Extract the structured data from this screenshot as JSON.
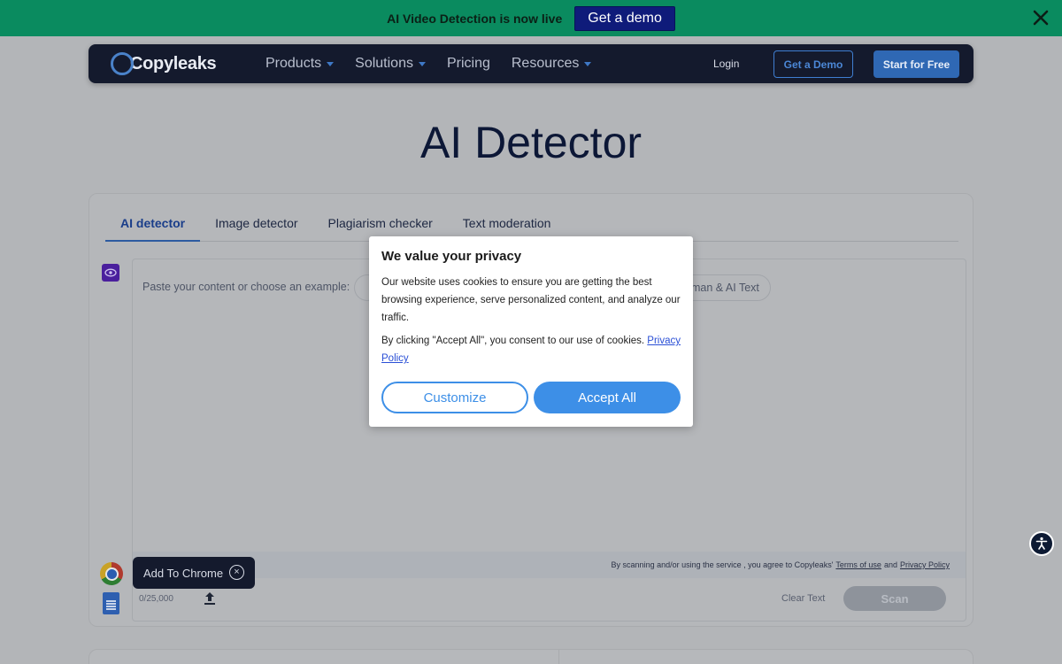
{
  "promo": {
    "text": "AI Video Detection is now live",
    "cta": "Get a demo",
    "close_icon": "close-icon"
  },
  "nav": {
    "logo": "Copyleaks",
    "menu": [
      {
        "label": "Products",
        "has_caret": true
      },
      {
        "label": "Solutions",
        "has_caret": true
      },
      {
        "label": "Pricing",
        "has_caret": false
      },
      {
        "label": "Resources",
        "has_caret": true
      }
    ],
    "login": "Login",
    "get_demo": "Get a Demo",
    "start_free": "Start for Free"
  },
  "page": {
    "title": "AI Detector"
  },
  "tabs": [
    {
      "label": "AI detector",
      "active": true
    },
    {
      "label": "Image detector",
      "active": false
    },
    {
      "label": "Plagiarism checker",
      "active": false
    },
    {
      "label": "Text moderation",
      "active": false
    }
  ],
  "editor": {
    "placeholder": "Paste your content or choose an example:",
    "example_chip": "man & AI Text",
    "terms_prefix": "By scanning and/or using the service , you agree to Copyleaks'",
    "terms_link": "Terms of use",
    "terms_and": "and",
    "privacy_link": "Privacy Policy",
    "counter": "0/25,000",
    "clear_text": "Clear Text",
    "scan": "Scan"
  },
  "chrome_ext": {
    "label": "Add To Chrome",
    "close": "×"
  },
  "modal": {
    "title": "We value your privacy",
    "body1": "Our website uses cookies to ensure you are getting the best browsing experience, serve personalized content, and analyze our traffic.",
    "body2_prefix": "By clicking \"Accept All\", you consent to our use of cookies.",
    "privacy_link": "Privacy Policy",
    "customize": "Customize",
    "accept_all": "Accept All"
  },
  "colors": {
    "promo_bg": "#0a8b5f",
    "nav_bg": "#141a2d",
    "accent_blue": "#3d8fe7",
    "overlay_bg": "#b3b5b8"
  }
}
